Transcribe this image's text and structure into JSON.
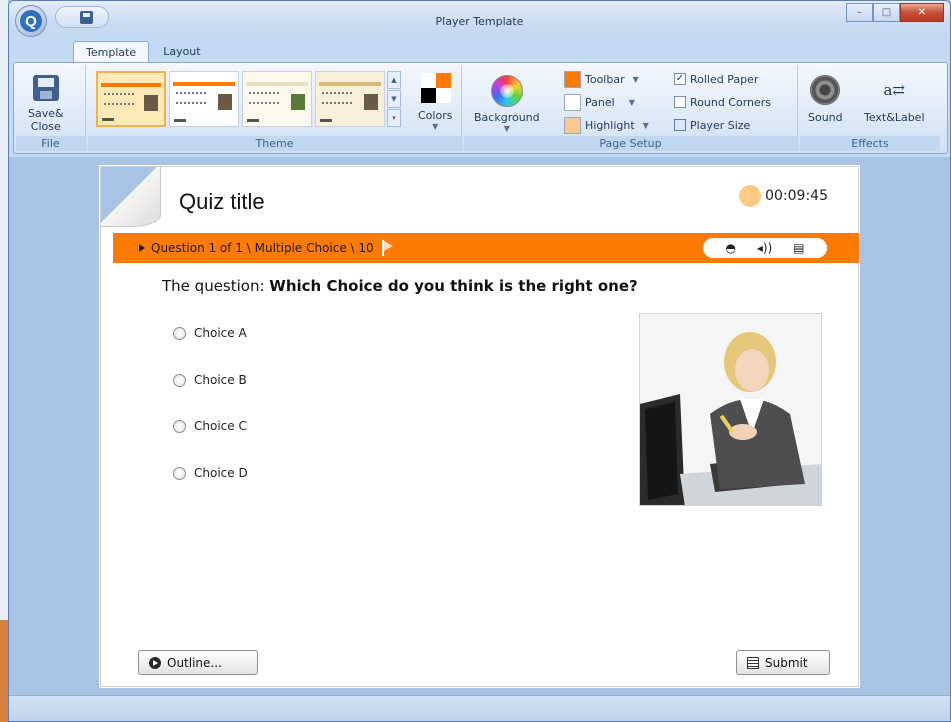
{
  "window": {
    "title": "Player Template"
  },
  "tabs": [
    {
      "label": "Template",
      "active": true
    },
    {
      "label": "Layout",
      "active": false
    }
  ],
  "ribbon": {
    "file": {
      "label": "File",
      "save_close_line1": "Save&",
      "save_close_line2": "Close"
    },
    "theme": {
      "label": "Theme",
      "colors_label": "Colors"
    },
    "page_setup": {
      "label": "Page Setup",
      "background_label": "Background",
      "toolbar_label": "Toolbar",
      "panel_label": "Panel",
      "highlight_label": "Highlight",
      "rolled_paper_label": "Rolled Paper",
      "rolled_paper_checked": true,
      "round_corners_label": "Round Corners",
      "round_corners_checked": false,
      "player_size_label": "Player Size",
      "swatches": {
        "toolbar": "#ff7a00",
        "panel": "#ffffff",
        "highlight": "#fdc98f"
      }
    },
    "effects": {
      "label": "Effects",
      "sound_label": "Sound",
      "text_label": "Text&Label"
    }
  },
  "quiz": {
    "title": "Quiz title",
    "timer": "00:09:45",
    "question_info": "Question 1 of 1 \\ Multiple Choice \\ 10",
    "question_prefix": "The question: ",
    "question_text": "Which Choice do you think is the right one?",
    "choices": [
      "Choice A",
      "Choice B",
      "Choice C",
      "Choice D"
    ],
    "outline_label": "Outline...",
    "submit_label": "Submit"
  },
  "colors": {
    "accent": "#ff7a00",
    "timer": "#fdca81"
  },
  "icons": [
    "app-orb-icon",
    "save-icon",
    "minimize-icon",
    "maximize-icon",
    "close-icon",
    "color-wheel-icon",
    "speaker-icon",
    "text-label-icon",
    "player-size-icon",
    "flag-icon",
    "attachment-icon",
    "audio-icon",
    "print-icon",
    "play-icon",
    "list-icon"
  ]
}
